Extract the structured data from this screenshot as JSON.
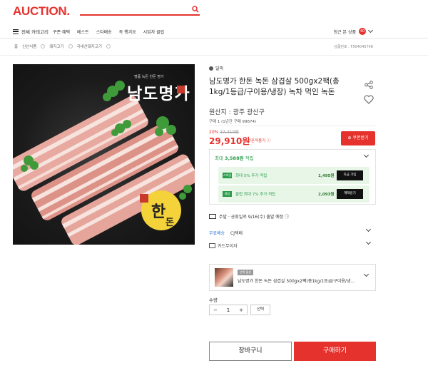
{
  "header": {
    "logo": "AUCTION.",
    "nav_all": "전체 카테고리",
    "nav_links": [
      "쿠폰·혜택",
      "베스트",
      "스타배송",
      "꼭 챙겨요",
      "시엄자 클럽"
    ],
    "recent_label": "최근 본 상품",
    "recent_count": "40"
  },
  "breadcrumb": [
    "홈",
    "신선식품",
    "돼지고기",
    "국내산돼지고기"
  ],
  "product_code": "상품번호 : F504045748",
  "product": {
    "store": "딜픽",
    "title": "남도명가 한돈 녹돈 삼겹살 500gx2팩(총1kg/1등급/구이용/냉장) 녹차 먹인 녹돈",
    "origin": "원산지 : 광주 광산구",
    "buy_info": "구매 1 (1년간 구매 99874)",
    "discount_pct": "20%",
    "original_price": "37,410원",
    "price": "29,910원",
    "price_label": "쿠폰적용가 ⓘ",
    "coupon_button": "⊕ 쿠폰받기",
    "image_brand": "남도명가",
    "image_sub": "명품 녹돈 한돈 명가"
  },
  "reward": {
    "header_prefix": "최대",
    "header_amount": "3,588원",
    "header_suffix": "적립",
    "rows": [
      {
        "tag": "스마일",
        "text": "최대 5% 추가 적립",
        "amount": "1,495원",
        "button": "지금 가입"
      },
      {
        "tag": "클럽",
        "text": "클럽 최대 7% 추가 적립",
        "amount": "2,093원",
        "button": "혜택받기"
      }
    ]
  },
  "shipping": {
    "eta": "주말 · 공휴일로 9/16(수) 출발 예정 ⓘ",
    "free_label": "무료배송",
    "carrier": "CJ택배",
    "card_info": "카드무이자"
  },
  "option": {
    "tag": "선택 옵션",
    "name": "남도명가 한돈 녹돈 삼겹살 500gx2팩(총1kg/1등급/구이용/냉..."
  },
  "quantity": {
    "label": "수량",
    "value": "1",
    "minus": "−",
    "plus": "+",
    "select_label": "선택"
  },
  "actions": {
    "cart": "장바구니",
    "buy": "구매하기"
  }
}
